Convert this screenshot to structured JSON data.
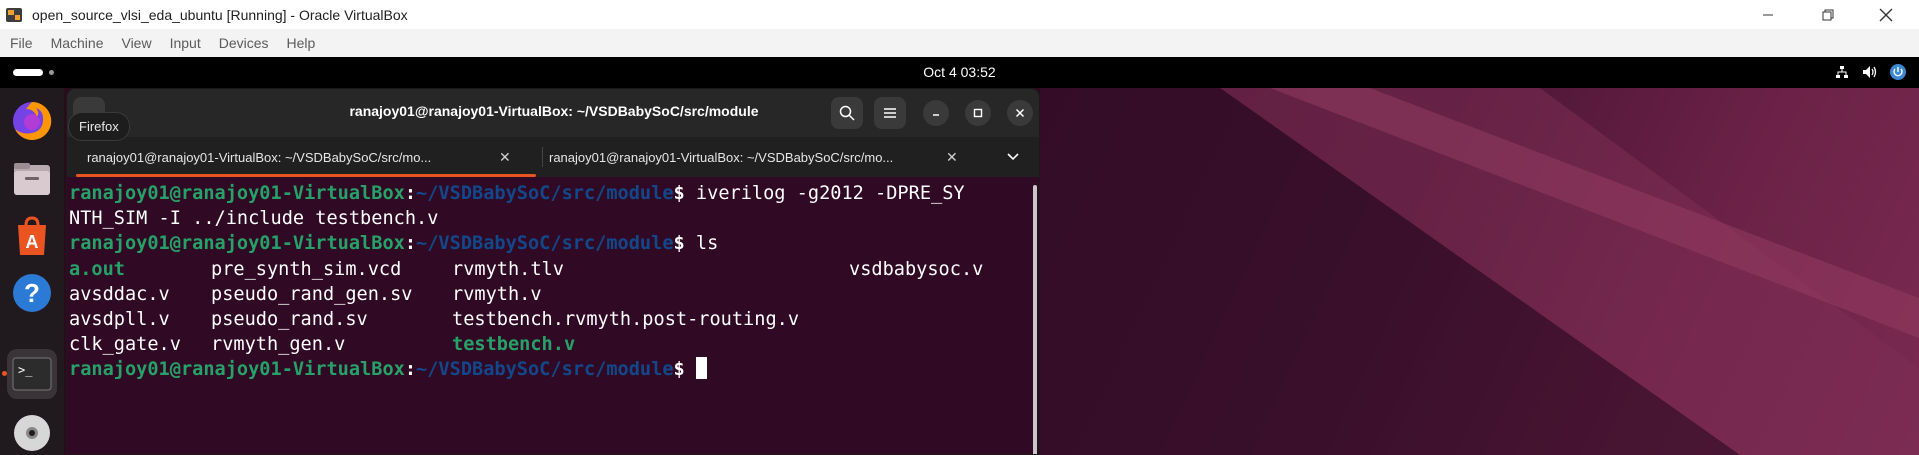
{
  "vbox": {
    "title": "open_source_vlsi_eda_ubuntu [Running] - Oracle VirtualBox",
    "menu": [
      "File",
      "Machine",
      "View",
      "Input",
      "Devices",
      "Help"
    ]
  },
  "gnome": {
    "clock": "Oct 4  03:52"
  },
  "dock": {
    "tooltip": "Firefox",
    "items": [
      "firefox",
      "files",
      "app-center",
      "help",
      "terminal",
      "disc"
    ]
  },
  "terminal": {
    "title": "ranajoy01@ranajoy01-VirtualBox: ~/VSDBabySoC/src/module",
    "tabs": [
      {
        "label": "ranajoy01@ranajoy01-VirtualBox: ~/VSDBabySoC/src/mo..."
      },
      {
        "label": "ranajoy01@ranajoy01-VirtualBox: ~/VSDBabySoC/src/mo..."
      }
    ],
    "prompt_user": "ranajoy01@ranajoy01-VirtualBox",
    "prompt_colon": ":",
    "prompt_path": "~/VSDBabySoC/src/module",
    "prompt_dollar": "$",
    "cmd1_part1": " iverilog -g2012 -DPRE_SY",
    "cmd1_part2": "NTH_SIM -I ../include testbench.v",
    "cmd2": " ls",
    "ls_rows": [
      [
        "a.out",
        "pre_synth_sim.vcd",
        "rvmyth.tlv",
        "vsdbabysoc.v"
      ],
      [
        "avsddac.v",
        "pseudo_rand_gen.sv",
        "rvmyth.v",
        ""
      ],
      [
        "avsdpll.v",
        "pseudo_rand.sv",
        "testbench.rvmyth.post-routing.v",
        ""
      ],
      [
        "clk_gate.v",
        "rvmyth_gen.v",
        "testbench.v",
        ""
      ]
    ]
  },
  "colors": {
    "terminal_bg": "#300a24",
    "prompt_user": "#26a269",
    "prompt_path": "#12488b",
    "accent": "#e95420"
  }
}
